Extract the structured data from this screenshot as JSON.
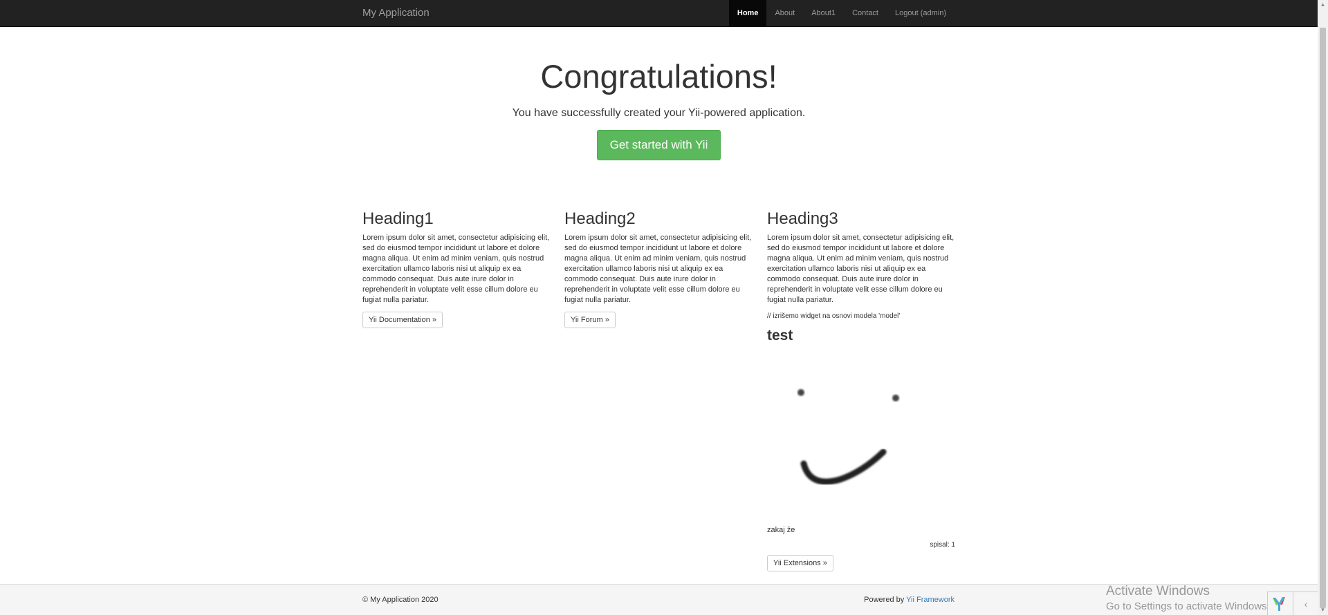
{
  "nav": {
    "brand": "My Application",
    "items": [
      {
        "label": "Home",
        "active": true
      },
      {
        "label": "About",
        "active": false
      },
      {
        "label": "About1",
        "active": false
      },
      {
        "label": "Contact",
        "active": false
      },
      {
        "label": "Logout (admin)",
        "active": false
      }
    ]
  },
  "jumbotron": {
    "title": "Congratulations!",
    "lead": "You have successfully created your Yii-powered application.",
    "cta": "Get started with Yii"
  },
  "columns": [
    {
      "heading": "Heading1",
      "body": "Lorem ipsum dolor sit amet, consectetur adipisicing elit, sed do eiusmod tempor incididunt ut labore et dolore magna aliqua. Ut enim ad minim veniam, quis nostrud exercitation ullamco laboris nisi ut aliquip ex ea commodo consequat. Duis aute irure dolor in reprehenderit in voluptate velit esse cillum dolore eu fugiat nulla pariatur.",
      "button": "Yii Documentation »"
    },
    {
      "heading": "Heading2",
      "body": "Lorem ipsum dolor sit amet, consectetur adipisicing elit, sed do eiusmod tempor incididunt ut labore et dolore magna aliqua. Ut enim ad minim veniam, quis nostrud exercitation ullamco laboris nisi ut aliquip ex ea commodo consequat. Duis aute irure dolor in reprehenderit in voluptate velit esse cillum dolore eu fugiat nulla pariatur.",
      "button": "Yii Forum »"
    },
    {
      "heading": "Heading3",
      "body": "Lorem ipsum dolor sit amet, consectetur adipisicing elit, sed do eiusmod tempor incididunt ut labore et dolore magna aliqua. Ut enim ad minim veniam, quis nostrud exercitation ullamco laboris nisi ut aliquip ex ea commodo consequat. Duis aute irure dolor in reprehenderit in voluptate velit esse cillum dolore eu fugiat nulla pariatur.",
      "comment": "// izrišemo widget na osnovi modela 'model'",
      "widget": {
        "title": "test",
        "image": "smiley-face-drawing",
        "text": "zakaj že",
        "author": "spisal: 1"
      },
      "button": "Yii Extensions »"
    }
  ],
  "footer": {
    "copyright": "© My Application 2020",
    "powered_prefix": "Powered by ",
    "powered_link": "Yii Framework",
    "link_color": "#337ab7"
  },
  "watermark": {
    "line1": "Activate Windows",
    "line2": "Go to Settings to activate Windows."
  },
  "debug_toolbar": {
    "logo": "yii-logo-icon",
    "toggle": "‹"
  },
  "colors": {
    "navbar": "#222222",
    "success": "#5cb85c",
    "link": "#337ab7"
  }
}
